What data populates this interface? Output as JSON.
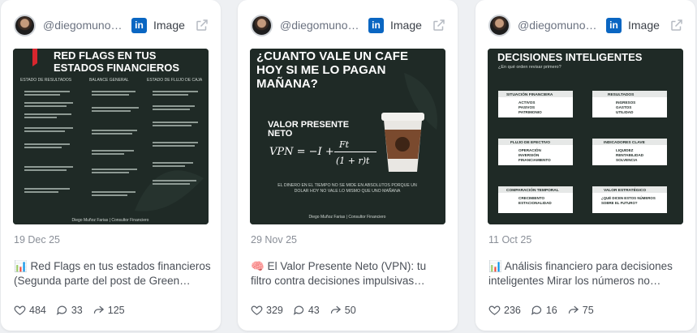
{
  "posts": [
    {
      "author": "@diegomuno…",
      "type_label": "Image",
      "date": "19 Dec 25",
      "caption": "📊 Red Flags en tus estados financieros (Segunda parte del post de Green Flags…",
      "likes": "484",
      "comments": "33",
      "shares": "125",
      "thumb": {
        "title_line1": "RED FLAGS EN TUS",
        "title_line2": "ESTADOS FINANCIEROS",
        "col1": "ESTADO DE RESULTADOS",
        "col2": "BALANCE GENERAL",
        "col3": "ESTADO DE FLUJO DE CAJA",
        "footer": "Diego Muñoz Farias | Consultor Financiero"
      }
    },
    {
      "author": "@diegomuno…",
      "type_label": "Image",
      "date": "29 Nov 25",
      "caption": "🧠 El Valor Presente Neto (VPN): tu filtro contra decisiones impulsivas Imagina…",
      "likes": "329",
      "comments": "43",
      "shares": "50",
      "thumb": {
        "title_line1": "¿CUANTO VALE UN CAFE",
        "title_line2": "HOY SI ME LO PAGAN",
        "title_line3": "MAÑANA?",
        "sub1": "VALOR PRESENTE",
        "sub2": "NETO",
        "formula": "VPN = −I +",
        "frac_top": "Ft",
        "frac_bottom": "(1 + r)t",
        "note1": "EL DINERO EN EL TIEMPO NO SE MIDE EN ABSOLUTOS PORQUE UN",
        "note2": "DOLAR HOY NO VALE LO MISMO QUE UNO MAÑANA",
        "footer": "Diego Muñoz Farias | Consultor Financiero"
      }
    },
    {
      "author": "@diegomuno…",
      "type_label": "Image",
      "date": "11 Oct 25",
      "caption": "📊 Análisis financiero para decisiones inteligentes Mirar los números no basta…",
      "likes": "236",
      "comments": "16",
      "shares": "75",
      "thumb": {
        "title": "DECISIONES INTELIGENTES",
        "subtitle": "¿En qué orden revisar primero?",
        "box1_title": "SITUACIÓN FINANCIERA",
        "box1_items": [
          "ACTIVOS",
          "PASIVOS",
          "PATRIMONIO"
        ],
        "box2_title": "RESULTADOS",
        "box2_items": [
          "INGRESOS",
          "GASTOS",
          "UTILIDAD"
        ],
        "box3_title": "FLUJO DE EFECTIVO",
        "box3_items": [
          "OPERACIÓN",
          "INVERSIÓN",
          "FINANCIAMIENTO"
        ],
        "box4_title": "INDICADORES CLAVE",
        "box4_items": [
          "LIQUIDEZ",
          "RENTABILIDAD",
          "SOLVENCIA"
        ],
        "box5_title": "COMPARACIÓN TEMPORAL",
        "box5_items": [
          "CRECIMIENTO",
          "ESTACIONALIDAD"
        ],
        "box6_title": "VALOR ESTRATÉGICO",
        "box6_items": [
          "¿QUÉ DICEN ESTOS NÚMEROS",
          "SOBRE EL FUTURO?"
        ]
      }
    }
  ],
  "colors": {
    "page_bg": "#eef0f3",
    "card_bg": "#ffffff",
    "linkedin_blue": "#0a66c2",
    "thumb_dark": "#1f2a26",
    "red_flag": "#d8262e"
  },
  "icons": [
    "avatar",
    "linkedin-icon",
    "external-link-icon",
    "heart-icon",
    "comment-icon",
    "share-icon"
  ]
}
